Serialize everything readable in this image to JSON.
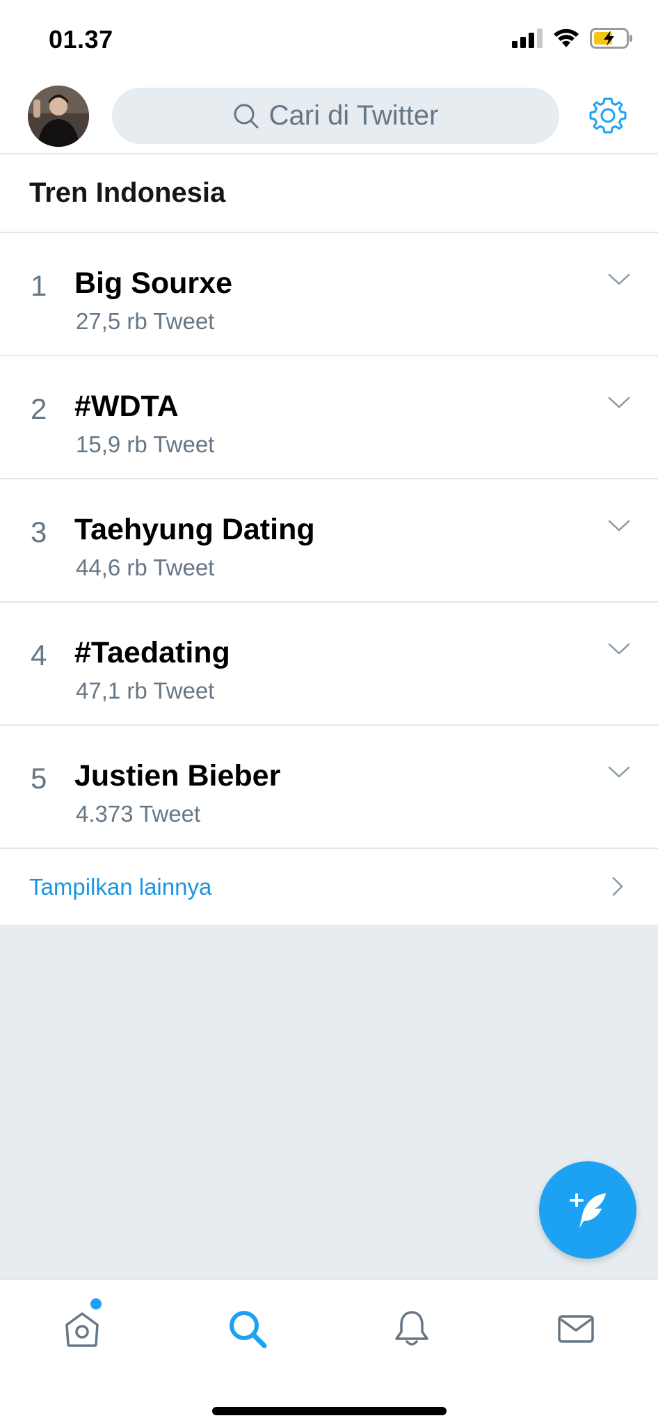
{
  "status_bar": {
    "time": "01.37"
  },
  "header": {
    "search_placeholder": "Cari di Twitter"
  },
  "trends": {
    "title": "Tren Indonesia",
    "items": [
      {
        "rank": "1",
        "name": "Big Sourxe",
        "count": "27,5 rb Tweet"
      },
      {
        "rank": "2",
        "name": "#WDTA",
        "count": "15,9 rb Tweet"
      },
      {
        "rank": "3",
        "name": "Taehyung Dating",
        "count": "44,6 rb Tweet"
      },
      {
        "rank": "4",
        "name": "#Taedating",
        "count": "47,1 rb Tweet"
      },
      {
        "rank": "5",
        "name": "Justien Bieber",
        "count": "4.373 Tweet"
      }
    ],
    "show_more": "Tampilkan lainnya"
  },
  "colors": {
    "accent": "#1da1f2",
    "link": "#1b95e0",
    "secondary_text": "#657786",
    "background": "#e6ecf0"
  },
  "tabbar": {
    "items": [
      "home-icon",
      "search-icon",
      "bell-icon",
      "mail-icon"
    ],
    "active": "search-icon",
    "home_has_notification": true
  }
}
